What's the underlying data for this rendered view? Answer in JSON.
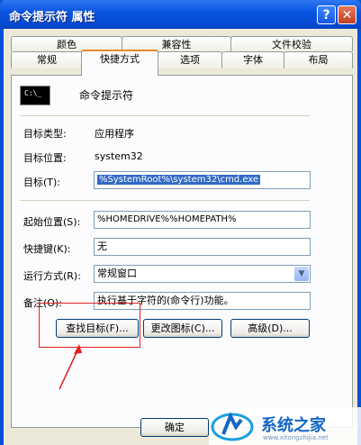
{
  "window": {
    "title": "命令提示符 属性",
    "help_glyph": "?",
    "close_glyph": "✕"
  },
  "tabs_row_back": [
    "颜色",
    "兼容性",
    "文件校验"
  ],
  "tabs_row_front": [
    "常规",
    "快捷方式",
    "选项",
    "字体",
    "布局"
  ],
  "active_tab": "快捷方式",
  "shortcut": {
    "name": "命令提示符",
    "icon_text": "C:\\_",
    "target_type_label": "目标类型:",
    "target_type_value": "应用程序",
    "target_location_label": "目标位置:",
    "target_location_value": "system32",
    "target_label": "目标(T):",
    "target_value": "%SystemRoot%\\system32\\cmd.exe",
    "start_in_label": "起始位置(S):",
    "start_in_value": "%HOMEDRIVE%%HOMEPATH%",
    "hotkey_label": "快捷键(K):",
    "hotkey_value": "无",
    "run_label": "运行方式(R):",
    "run_value": "常规窗口",
    "comment_label": "备注(O):",
    "comment_value": "执行基于字符的(命令行)功能。"
  },
  "buttons": {
    "find_target": "查找目标(F)...",
    "change_icon": "更改图标(C)...",
    "advanced": "高级(D)...",
    "ok": "确定"
  },
  "watermark": {
    "text": "系统之家",
    "url_text": "www.xitongzhijia.net"
  },
  "colors": {
    "title_bar": "#0a56e0",
    "highlight": "#e02020",
    "selection": "#316ac5",
    "dialog_face": "#ece9d8"
  }
}
